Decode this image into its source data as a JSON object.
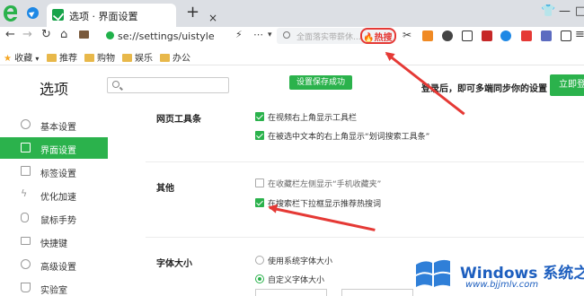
{
  "tabbar": {
    "active_tab_title": "选项 · 界面设置",
    "new_tab": "+",
    "close_tab": "×",
    "window_controls": [
      "👕",
      "—",
      "□"
    ]
  },
  "addressbar": {
    "url": "se://settings/uistyle",
    "search_placeholder": "全面落实带薪休...",
    "hot_label": "🔥热搜",
    "nav": {
      "back": "←",
      "forward": "→",
      "refresh": "↻",
      "home": "⌂"
    }
  },
  "bookmarks": [
    {
      "label": "收藏",
      "icon": "star-icon"
    },
    {
      "label": "推荐",
      "icon": "folder-icon"
    },
    {
      "label": "购物",
      "icon": "folder-icon"
    },
    {
      "label": "娱乐",
      "icon": "folder-icon"
    },
    {
      "label": "办公",
      "icon": "folder-icon"
    }
  ],
  "header": {
    "title": "选项",
    "toast": "设置保存成功",
    "login_tip": "登录后，即可多端同步你的设置",
    "login_button": "立即登录"
  },
  "sidebar": {
    "items": [
      {
        "label": "基本设置",
        "active": false
      },
      {
        "label": "界面设置",
        "active": true
      },
      {
        "label": "标签设置",
        "active": false
      },
      {
        "label": "优化加速",
        "active": false
      },
      {
        "label": "鼠标手势",
        "active": false
      },
      {
        "label": "快捷键",
        "active": false
      },
      {
        "label": "高级设置",
        "active": false
      },
      {
        "label": "实验室",
        "active": false
      }
    ]
  },
  "sections": {
    "toolbar": {
      "title": "网页工具条",
      "options": [
        {
          "label": "在视频右上角显示工具栏",
          "checked": true
        },
        {
          "label": "在被选中文本的右上角显示“划词搜索工具条”",
          "checked": true
        }
      ]
    },
    "other": {
      "title": "其他",
      "options": [
        {
          "label": "在收藏栏左侧显示“手机收藏夹”",
          "checked": false
        },
        {
          "label": "在搜索栏下拉框显示推荐热搜词",
          "checked": true
        }
      ]
    },
    "font": {
      "title": "字体大小",
      "options": [
        {
          "label": "使用系统字体大小",
          "selected": false
        },
        {
          "label": "自定义字体大小",
          "selected": true
        }
      ]
    }
  },
  "watermark": {
    "brand": "Windows 系统之家",
    "url": "www.bjjmlv.com"
  },
  "colors": {
    "accent": "#2bb24c",
    "annotation": "#e53935",
    "watermark": "#1e5fbf"
  }
}
